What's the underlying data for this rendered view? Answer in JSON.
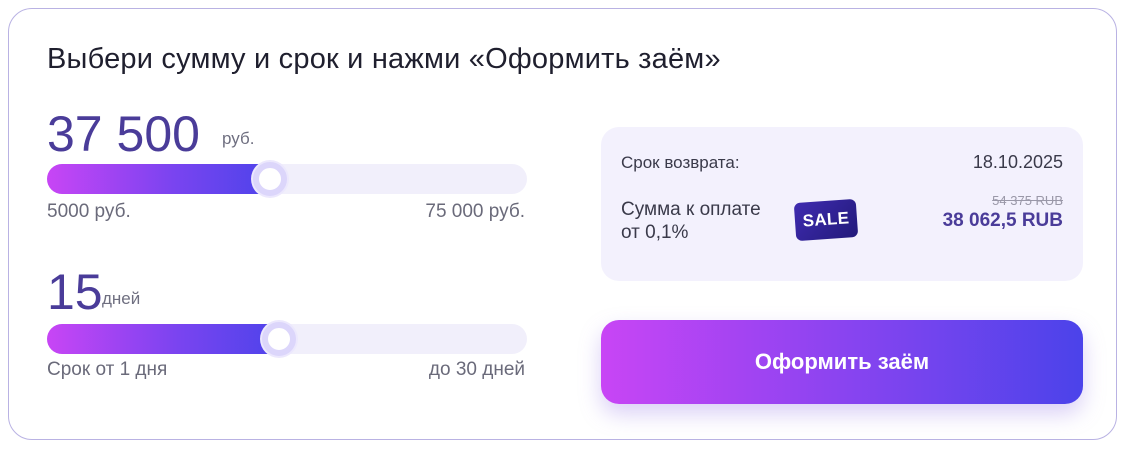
{
  "header": {
    "title": "Выбери сумму и срок и нажми «Оформить заём»"
  },
  "amount": {
    "value": "37 500",
    "unit": "руб.",
    "min_label": "5000 руб.",
    "max_label": "75 000 руб.",
    "min": 5000,
    "max": 75000,
    "current": 37500
  },
  "term": {
    "value": "15",
    "unit": "дней",
    "min_label": "Срок от 1 дня",
    "max_label": "до 30 дней",
    "min": 1,
    "max": 30,
    "current": 15
  },
  "summary": {
    "return_label": "Срок возврата:",
    "return_date": "18.10.2025",
    "pay_label_line1": "Сумма к оплате",
    "pay_label_line2": "от 0,1%",
    "sale_badge": "SALE",
    "old_price": "54 375 RUB",
    "new_price": "38 062,5 RUB"
  },
  "cta": {
    "label": "Оформить заём"
  },
  "colors": {
    "accent": "#4a3c99",
    "gradient_start": "#c845f5",
    "gradient_end": "#4b43ea",
    "panel_bg": "#f3f1fd"
  }
}
